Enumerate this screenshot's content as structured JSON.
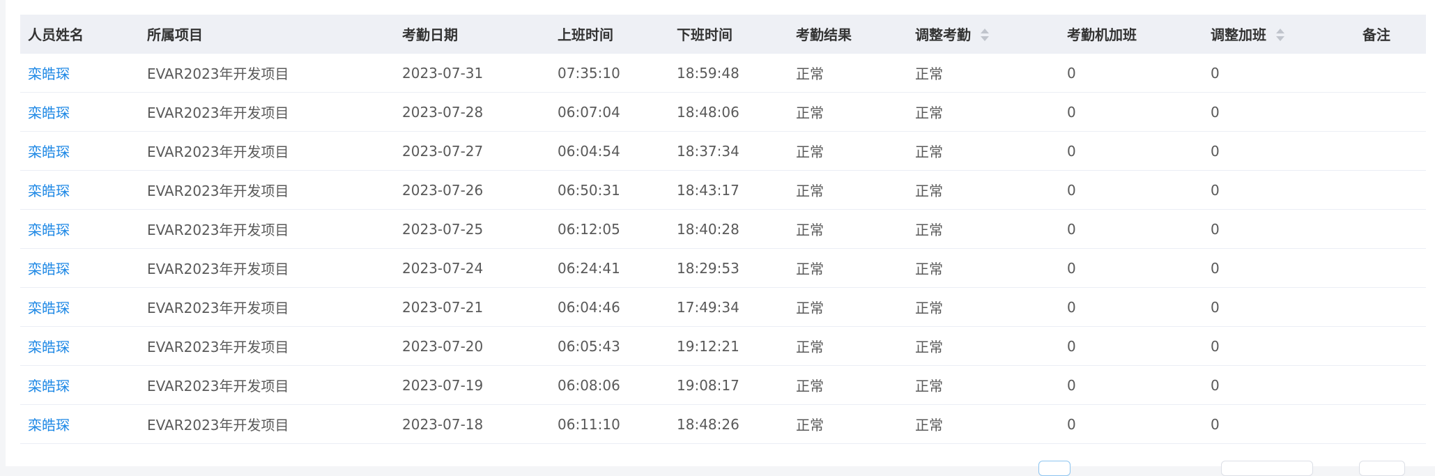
{
  "table": {
    "columns": [
      {
        "label": "人员姓名",
        "sortable": false
      },
      {
        "label": "所属项目",
        "sortable": false
      },
      {
        "label": "考勤日期",
        "sortable": false
      },
      {
        "label": "上班时间",
        "sortable": false
      },
      {
        "label": "下班时间",
        "sortable": false
      },
      {
        "label": "考勤结果",
        "sortable": false
      },
      {
        "label": "调整考勤",
        "sortable": true
      },
      {
        "label": "考勤机加班",
        "sortable": false
      },
      {
        "label": "调整加班",
        "sortable": true
      },
      {
        "label": "备注",
        "sortable": false
      }
    ],
    "rows": [
      [
        "栾皓琛",
        "EVAR2023年开发项目",
        "2023-07-31",
        "07:35:10",
        "18:59:48",
        "正常",
        "正常",
        "0",
        "0",
        ""
      ],
      [
        "栾皓琛",
        "EVAR2023年开发项目",
        "2023-07-28",
        "06:07:04",
        "18:48:06",
        "正常",
        "正常",
        "0",
        "0",
        ""
      ],
      [
        "栾皓琛",
        "EVAR2023年开发项目",
        "2023-07-27",
        "06:04:54",
        "18:37:34",
        "正常",
        "正常",
        "0",
        "0",
        ""
      ],
      [
        "栾皓琛",
        "EVAR2023年开发项目",
        "2023-07-26",
        "06:50:31",
        "18:43:17",
        "正常",
        "正常",
        "0",
        "0",
        ""
      ],
      [
        "栾皓琛",
        "EVAR2023年开发项目",
        "2023-07-25",
        "06:12:05",
        "18:40:28",
        "正常",
        "正常",
        "0",
        "0",
        ""
      ],
      [
        "栾皓琛",
        "EVAR2023年开发项目",
        "2023-07-24",
        "06:24:41",
        "18:29:53",
        "正常",
        "正常",
        "0",
        "0",
        ""
      ],
      [
        "栾皓琛",
        "EVAR2023年开发项目",
        "2023-07-21",
        "06:04:46",
        "17:49:34",
        "正常",
        "正常",
        "0",
        "0",
        ""
      ],
      [
        "栾皓琛",
        "EVAR2023年开发项目",
        "2023-07-20",
        "06:05:43",
        "19:12:21",
        "正常",
        "正常",
        "0",
        "0",
        ""
      ],
      [
        "栾皓琛",
        "EVAR2023年开发项目",
        "2023-07-19",
        "06:08:06",
        "19:08:17",
        "正常",
        "正常",
        "0",
        "0",
        ""
      ],
      [
        "栾皓琛",
        "EVAR2023年开发项目",
        "2023-07-18",
        "06:11:10",
        "18:48:26",
        "正常",
        "正常",
        "0",
        "0",
        ""
      ]
    ]
  },
  "colors": {
    "link": "#1e88e5",
    "header_bg": "#eef0f5",
    "text": "#595959",
    "border": "#ebeef5"
  }
}
